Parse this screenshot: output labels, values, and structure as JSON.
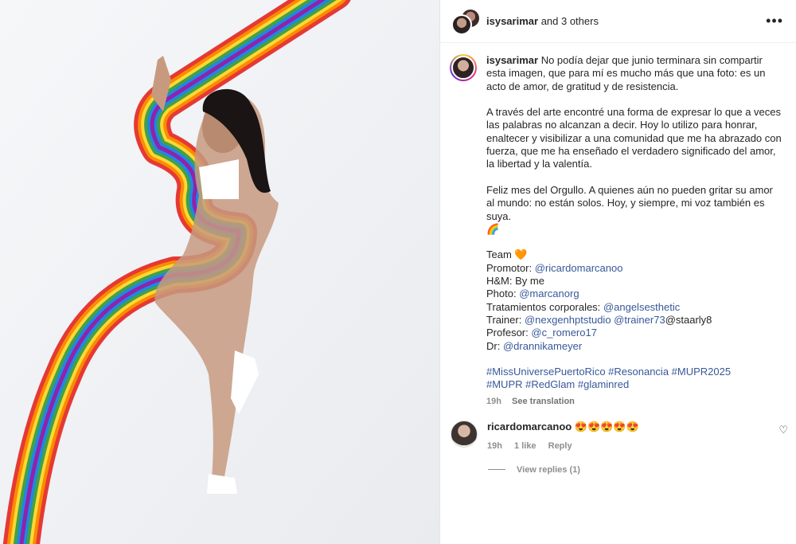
{
  "header": {
    "username": "isysarimar",
    "others": "and 3 others"
  },
  "caption": {
    "username": "isysarimar",
    "text_p1": "No podía dejar que junio terminara sin compartir esta imagen, que para mí es mucho más que una foto: es un acto de amor, de gratitud y de resistencia.",
    "text_p2": "A través del arte encontré una forma de expresar lo que a veces las palabras no alcanzan a decir. Hoy lo utilizo para honrar, enaltecer y visibilizar a una comunidad que me ha abrazado con fuerza, que me ha enseñado el verdadero significado del amor, la libertad y la valentía.",
    "text_p3": "Feliz mes del Orgullo. A quienes aún no pueden gritar su amor al mundo: no están solos. Hoy, y siempre, mi voz también es suya.",
    "rainbow_emoji": "🌈",
    "team_label": "Team",
    "team_emoji": "🧡",
    "promotor_label": "Promotor:",
    "promotor": "@ricardomarcanoo",
    "hm_label": "H&M:",
    "hm": "By me",
    "photo_label": "Photo:",
    "photo": "@marcanorg",
    "tratamientos_label": "Tratamientos corporales:",
    "tratamientos": "@angelsesthetic",
    "trainer_label": "Trainer:",
    "trainer1": "@nexgenhptstudio",
    "trainer2": "@trainer73",
    "trainer3": "@staarly8",
    "profesor_label": "Profesor:",
    "profesor": "@c_romero17",
    "dr_label": "Dr:",
    "dr": "@drannikameyer",
    "hashtags_line1": "#MissUniversePuertoRico #Resonancia #MUPR2025",
    "hashtags_line2": "#MUPR #RedGlam #glaminred",
    "time": "19h",
    "see_translation": "See translation"
  },
  "comment": {
    "username": "ricardomarcanoo",
    "text": "😍😍😍😍😍",
    "time": "19h",
    "likes": "1 like",
    "reply": "Reply",
    "view_replies": "View replies (1)"
  },
  "icons": {
    "more": "more-horizontal-icon",
    "like": "heart-outline-icon"
  }
}
